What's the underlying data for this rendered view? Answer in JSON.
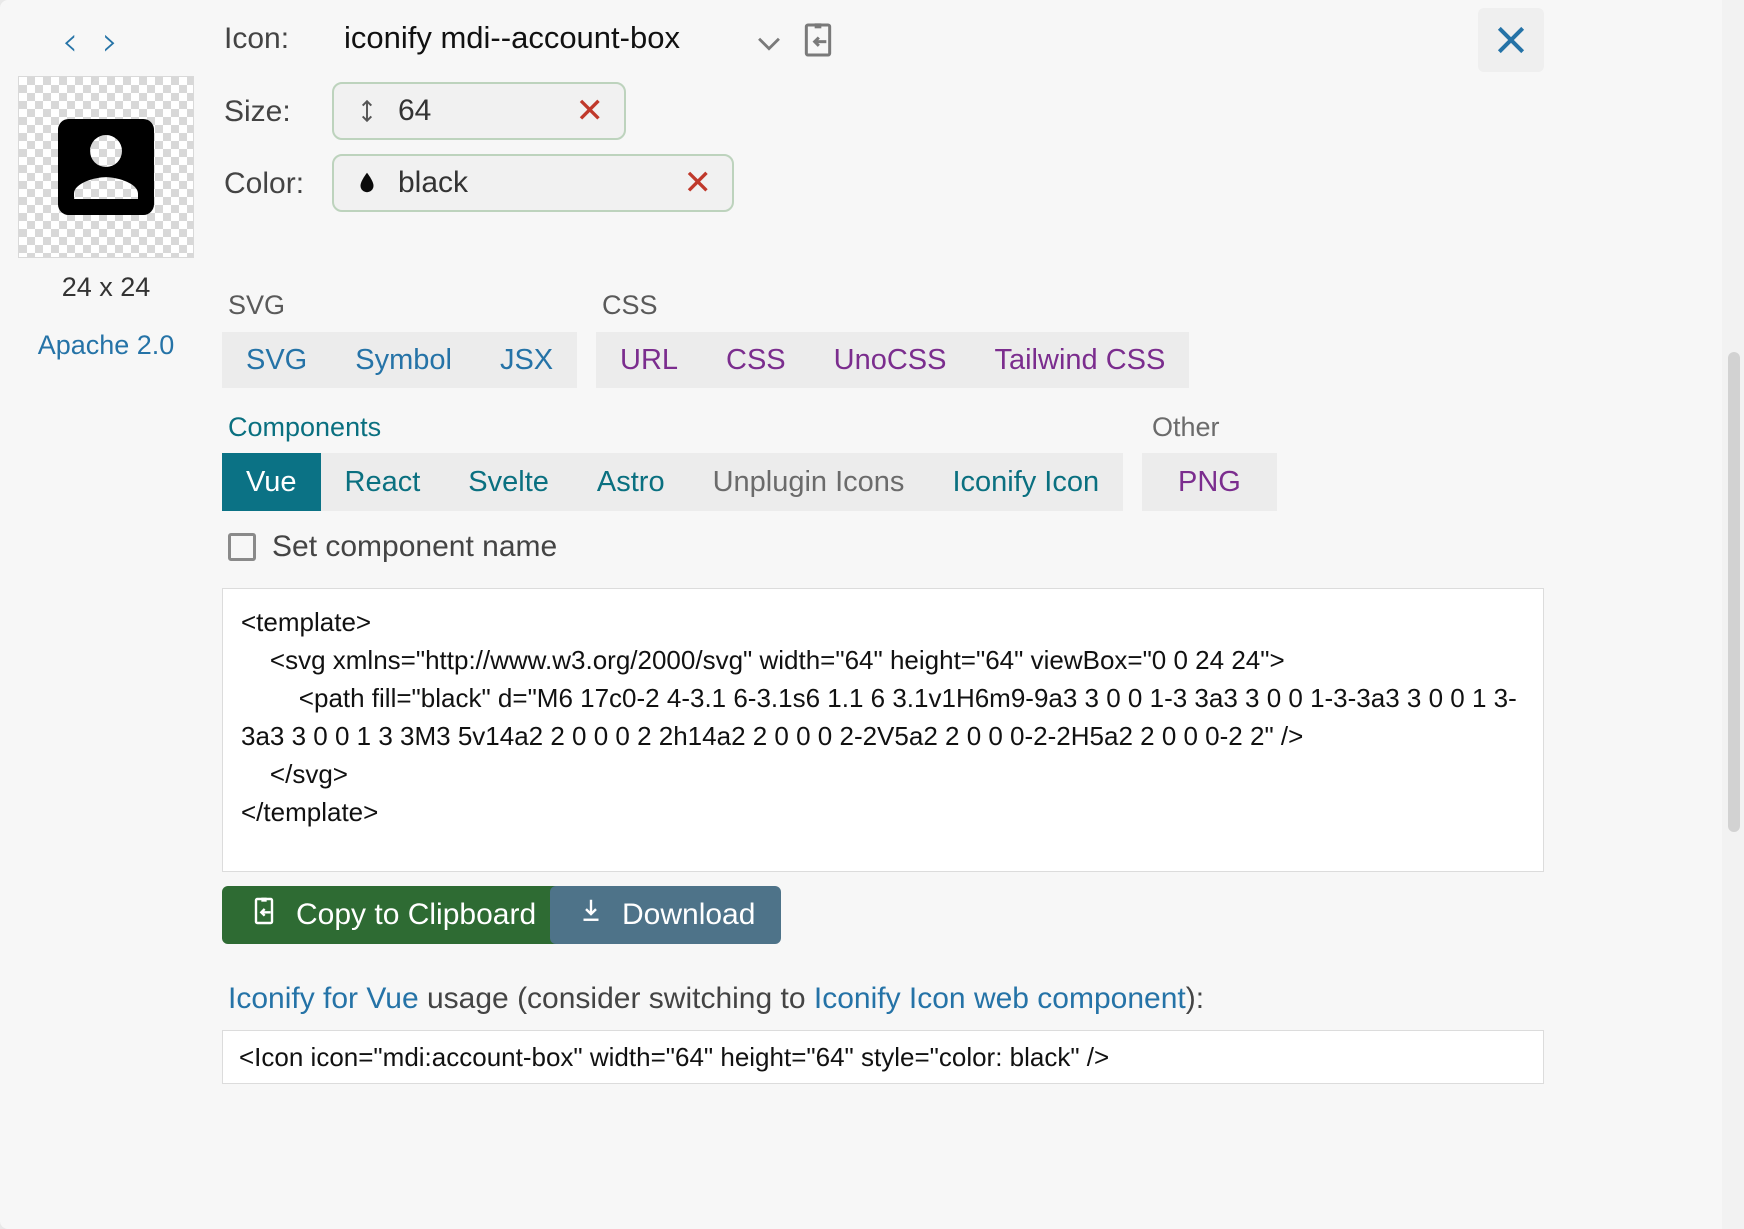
{
  "header": {
    "prev_label": "‹",
    "next_label": "›",
    "icon_label": "Icon:",
    "icon_name": "iconify mdi--account-box",
    "dropdown_icon": "chevron-down-icon",
    "paste_icon": "paste-to-clipboard-icon",
    "close_label": "close-icon",
    "accent_blue": "#2573a7"
  },
  "preview": {
    "dimensions": "24 x 24",
    "license": "Apache 2.0",
    "icon": "account-box-icon"
  },
  "fields": {
    "size": {
      "label": "Size:",
      "value": "64",
      "icon": "height-arrows-icon",
      "clear_label": "✕"
    },
    "color": {
      "label": "Color:",
      "value": "black",
      "icon": "color-drop-icon",
      "clear_label": "✕"
    }
  },
  "groups": {
    "svg": {
      "label": "SVG",
      "tabs": [
        {
          "label": "SVG",
          "style": "blue",
          "active": false
        },
        {
          "label": "Symbol",
          "style": "blue",
          "active": false
        },
        {
          "label": "JSX",
          "style": "blue",
          "active": false
        }
      ]
    },
    "css": {
      "label": "CSS",
      "tabs": [
        {
          "label": "URL",
          "style": "purple",
          "active": false
        },
        {
          "label": "CSS",
          "style": "purple",
          "active": false
        },
        {
          "label": "UnoCSS",
          "style": "purple",
          "active": false
        },
        {
          "label": "Tailwind CSS",
          "style": "purple",
          "active": false
        }
      ]
    },
    "components": {
      "label": "Components",
      "tabs": [
        {
          "label": "Vue",
          "style": "teal",
          "active": true
        },
        {
          "label": "React",
          "style": "teal",
          "active": false
        },
        {
          "label": "Svelte",
          "style": "teal",
          "active": false
        },
        {
          "label": "Astro",
          "style": "teal",
          "active": false
        },
        {
          "label": "Unplugin Icons",
          "style": "gray",
          "active": false
        },
        {
          "label": "Iconify Icon",
          "style": "teal",
          "active": false
        }
      ]
    },
    "other": {
      "label": "Other",
      "tabs": [
        {
          "label": "PNG",
          "style": "purple",
          "active": false
        }
      ]
    }
  },
  "options": {
    "set_component_name_label": "Set component name",
    "set_component_name_checked": false
  },
  "code": {
    "line1": "<template>",
    "line2": "    <svg xmlns=\"http://www.w3.org/2000/svg\" width=\"64\" height=\"64\" viewBox=\"0 0 24 24\">",
    "line3": "        <path fill=\"black\" d=\"M6 17c0-2 4-3.1 6-3.1s6 1.1 6 3.1v1H6m9-9a3 3 0 0 1-3 3a3 3 0 0 1-3-3a3 3 0 0 1 3-3a3 3 0 0 1 3 3M3 5v14a2 2 0 0 0 2 2h14a2 2 0 0 0 2-2V5a2 2 0 0 0-2-2H5a2 2 0 0 0-2 2\" />",
    "line4": "    </svg>",
    "line5": "</template>"
  },
  "actions": {
    "copy_label": "Copy to Clipboard",
    "copy_icon": "copy-to-clipboard-icon",
    "copy_color": "#2e6b33",
    "download_label": "Download",
    "download_icon": "download-icon",
    "download_color": "#4e7389"
  },
  "usage": {
    "link1": "Iconify for Vue",
    "mid_text": " usage (consider switching to ",
    "link2": "Iconify Icon web component",
    "tail_text": "):",
    "snippet": "<Icon icon=\"mdi:account-box\" width=\"64\" height=\"64\"  style=\"color: black\" />"
  }
}
